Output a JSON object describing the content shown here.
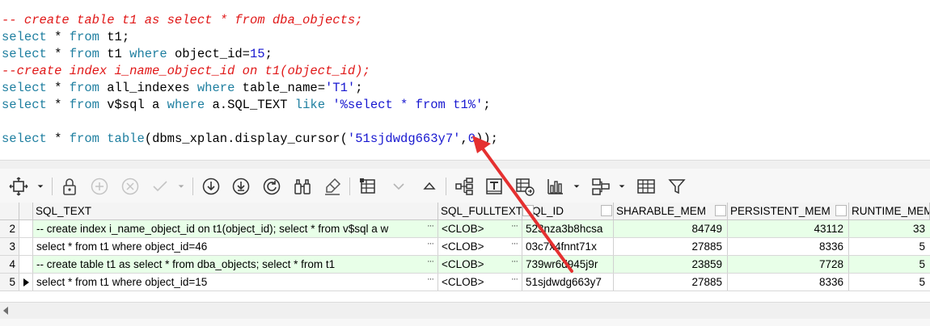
{
  "editor": {
    "line1": "-- create table t1 as select * from dba_objects;",
    "line2": {
      "k1": "select",
      "t1": " * ",
      "k2": "from",
      "t2": " t1;"
    },
    "line3": {
      "k1": "select",
      "t1": " * ",
      "k2": "from",
      "t2": " t1 ",
      "k3": "where",
      "t3": " object_id=",
      "n": "15",
      "t4": ";"
    },
    "line4": "--create index i_name_object_id on t1(object_id);",
    "line5": {
      "k1": "select",
      "t1": " * ",
      "k2": "from",
      "t2": " all_indexes ",
      "k3": "where",
      "t3": " table_name=",
      "s": "'T1'",
      "t4": ";"
    },
    "line6": {
      "k1": "select",
      "t1": " * ",
      "k2": "from",
      "t2": " v$sql a ",
      "k3": "where",
      "t3": " a.SQL_TEXT ",
      "k4": "like",
      "t4": " ",
      "s": "'%select * from t1%'",
      "t5": ";"
    },
    "line8": {
      "k1": "select",
      "t1": " * ",
      "k2": "from",
      "t2": " ",
      "k3": "table",
      "t3": "(dbms_xplan.display_cursor(",
      "s": "'51sjdwdg663y7'",
      "t4": ",",
      "n": "0",
      "t5": "));"
    }
  },
  "toolbar": {
    "icons": [
      "record-navigator-icon",
      "lock-icon",
      "add-record-icon",
      "delete-record-icon",
      "post-edit-icon",
      "first-record-icon",
      "prior-record-icon",
      "refresh-icon",
      "binoculars-icon",
      "clear-icon",
      "grid-view-icon",
      "filter-down-icon",
      "filter-up-icon",
      "tree-icon",
      "text-view-icon",
      "export-icon",
      "chart-icon",
      "layout-icon",
      "table-icon",
      "funnel-icon"
    ]
  },
  "grid": {
    "columns": [
      "SQL_TEXT",
      "SQL_FULLTEXT",
      "SQL_ID",
      "SHARABLE_MEM",
      "PERSISTENT_MEM",
      "RUNTIME_MEM"
    ],
    "rows": [
      {
        "n": "2",
        "sql_text": "-- create index i_name_object_id on t1(object_id); select * from v$sql a w",
        "fulltext": "<CLOB>",
        "sql_id": "523nza3b8hcsa",
        "sharable": "84749",
        "persistent": "43112",
        "runtime": "33"
      },
      {
        "n": "3",
        "sql_text": "select * from t1 where object_id=46",
        "fulltext": "<CLOB>",
        "sql_id": "03c7x4fnnt71x",
        "sharable": "27885",
        "persistent": "8336",
        "runtime": "5"
      },
      {
        "n": "4",
        "sql_text": "-- create table t1 as select * from dba_objects; select * from t1",
        "fulltext": "<CLOB>",
        "sql_id": "739wr6d945j9r",
        "sharable": "23859",
        "persistent": "7728",
        "runtime": "5"
      },
      {
        "n": "5",
        "sql_text": "select * from t1 where object_id=15",
        "fulltext": "<CLOB>",
        "sql_id": "51sjdwdg663y7",
        "sharable": "27885",
        "persistent": "8336",
        "runtime": "5"
      }
    ],
    "ellipsis": "···"
  },
  "colors": {
    "comment": "#e01818",
    "keyword": "#1f7fa0",
    "string": "#1818d0",
    "row_highlight": "#e8ffe8",
    "annotation_arrow": "#e53030"
  }
}
